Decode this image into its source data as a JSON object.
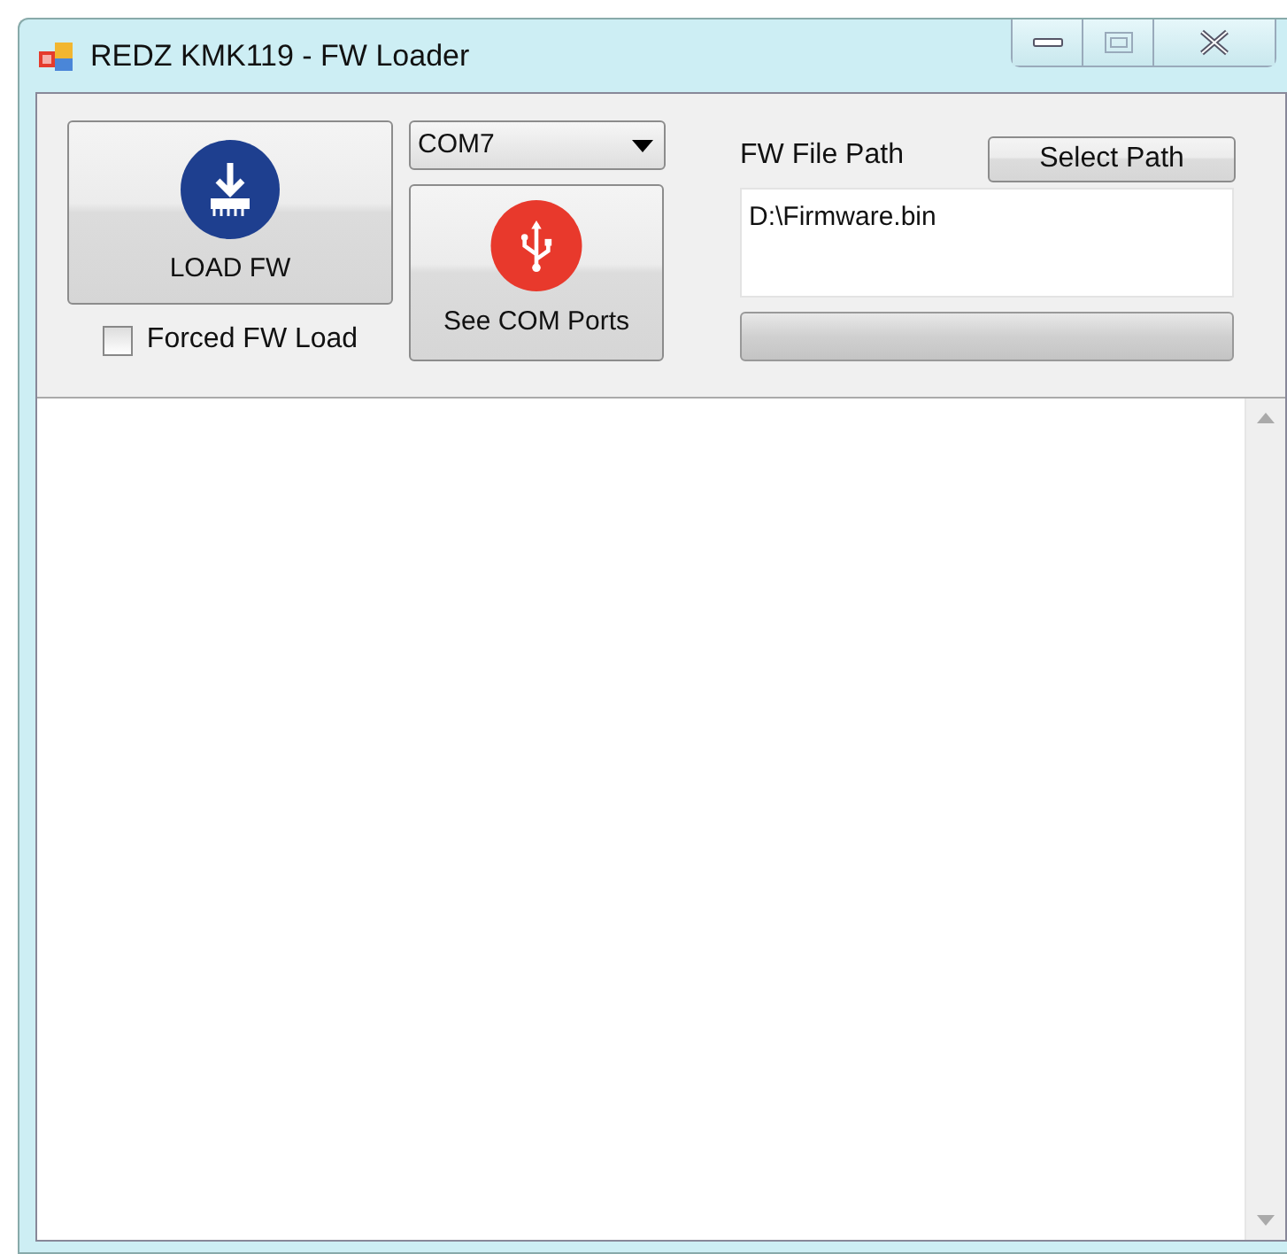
{
  "window": {
    "title": "REDZ KMK119 - FW Loader"
  },
  "load_button": {
    "label": "LOAD FW"
  },
  "forced_load": {
    "label": "Forced FW Load",
    "checked": false
  },
  "port_select": {
    "value": "COM7"
  },
  "ports_button": {
    "label": "See COM Ports"
  },
  "path_label": "FW File Path",
  "select_path_button": {
    "label": "Select Path"
  },
  "path_field": {
    "value": "D:\\Firmware.bin"
  },
  "progress": {
    "level": 0
  }
}
